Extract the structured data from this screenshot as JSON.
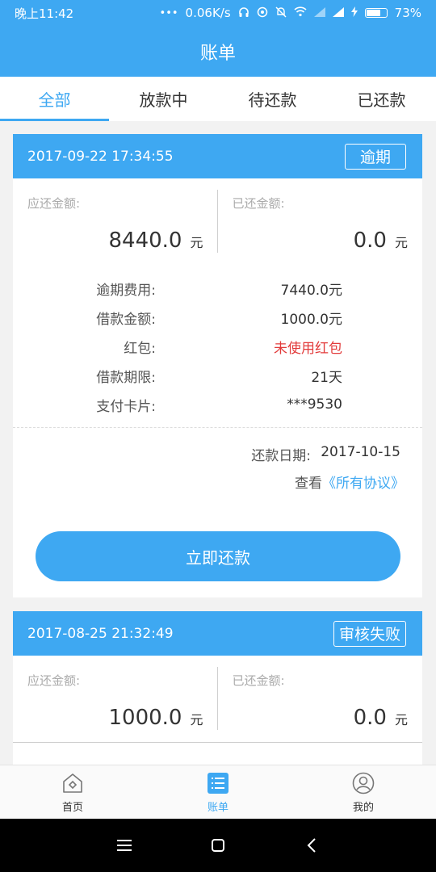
{
  "status_bar": {
    "time": "晚上11:42",
    "net_speed": "0.06K/s",
    "battery": "73%",
    "battery_level": 0.73
  },
  "app_bar": {
    "title": "账单"
  },
  "tabs": [
    {
      "label": "全部",
      "active": true
    },
    {
      "label": "放款中",
      "active": false
    },
    {
      "label": "待还款",
      "active": false
    },
    {
      "label": "已还款",
      "active": false
    }
  ],
  "bills": [
    {
      "datetime": "2017-09-22 17:34:55",
      "status": "逾期",
      "due_label": "应还金额:",
      "due_amount": "8440.0",
      "due_unit": "元",
      "paid_label": "已还金额:",
      "paid_amount": "0.0",
      "paid_unit": "元",
      "details": [
        {
          "key": "逾期费用:",
          "value": "7440.0元"
        },
        {
          "key": "借款金额:",
          "value": "1000.0元"
        },
        {
          "key": "红包:",
          "value": "未使用红包"
        },
        {
          "key": "借款期限:",
          "value": "21天"
        },
        {
          "key": "支付卡片:",
          "value": "***9530"
        }
      ],
      "repay_date_label": "还款日期:",
      "repay_date": "2017-10-15",
      "agreement_prefix": "查看",
      "agreement_link": "《所有协议》",
      "pay_button": "立即还款"
    },
    {
      "datetime": "2017-08-25 21:32:49",
      "status": "审核失败",
      "due_label": "应还金额:",
      "due_amount": "1000.0",
      "due_unit": "元",
      "paid_label": "已还金额:",
      "paid_amount": "0.0",
      "paid_unit": "元"
    }
  ],
  "bottom_nav": [
    {
      "label": "首页",
      "icon": "home-icon",
      "active": false
    },
    {
      "label": "账单",
      "icon": "bill-list-icon",
      "active": true
    },
    {
      "label": "我的",
      "icon": "profile-icon",
      "active": false
    }
  ],
  "colors": {
    "primary": "#3ea8f2",
    "warning": "#e23b3b"
  }
}
